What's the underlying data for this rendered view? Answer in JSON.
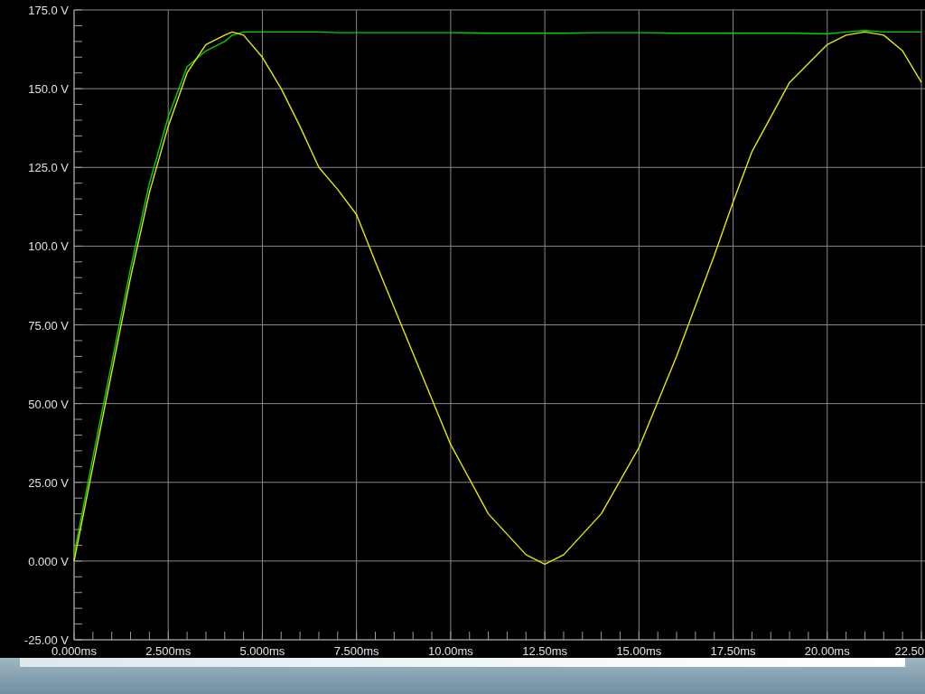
{
  "chart_data": {
    "type": "line",
    "x": [
      0,
      0.5,
      1,
      1.5,
      2,
      2.5,
      3,
      3.5,
      4,
      4.2,
      4.5,
      5,
      5.5,
      6,
      6.5,
      7,
      7.5,
      8,
      9,
      10,
      11,
      12,
      12.5,
      13,
      14,
      15,
      16,
      17,
      17.5,
      18,
      19,
      20,
      20.5,
      21,
      21.5,
      22,
      22.5
    ],
    "series": [
      {
        "color": "#e8e800",
        "values": [
          0,
          30,
          60,
          90,
          117,
          138,
          155,
          164,
          167,
          168,
          167,
          160,
          150,
          138,
          125,
          118,
          110,
          95,
          66,
          37,
          15,
          2,
          -1,
          2,
          15,
          36,
          65,
          97,
          114,
          130,
          152,
          164,
          167,
          168,
          167,
          162,
          152
        ]
      },
      {
        "color": "#00d000",
        "values": [
          2,
          33,
          63,
          93,
          120,
          141,
          157,
          162,
          165,
          167,
          168,
          168,
          168,
          168,
          168,
          167.8,
          167.8,
          167.8,
          167.8,
          167.8,
          167.6,
          167.6,
          167.6,
          167.6,
          167.8,
          167.8,
          167.6,
          167.6,
          167.6,
          167.6,
          167.6,
          167.4,
          168,
          168.5,
          168,
          168,
          168
        ]
      }
    ],
    "grid": true,
    "xlim": [
      0,
      22.5
    ],
    "ylim": [
      -25,
      175
    ],
    "xticks": [
      {
        "value": 0,
        "label": "0.000ms"
      },
      {
        "value": 2.5,
        "label": "2.500ms"
      },
      {
        "value": 5,
        "label": "5.000ms"
      },
      {
        "value": 7.5,
        "label": "7.500ms"
      },
      {
        "value": 10,
        "label": "10.00ms"
      },
      {
        "value": 12.5,
        "label": "12.50ms"
      },
      {
        "value": 15,
        "label": "15.00ms"
      },
      {
        "value": 17.5,
        "label": "17.50ms"
      },
      {
        "value": 20,
        "label": "20.00ms"
      },
      {
        "value": 22.5,
        "label": "22.50"
      }
    ],
    "yticks": [
      {
        "value": -25,
        "label": "-25.00 V"
      },
      {
        "value": 0,
        "label": "0.000 V"
      },
      {
        "value": 25,
        "label": "25.00 V"
      },
      {
        "value": 50,
        "label": "50.00 V"
      },
      {
        "value": 75,
        "label": "75.00 V"
      },
      {
        "value": 100,
        "label": "100.0 V"
      },
      {
        "value": 125,
        "label": "125.0 V"
      },
      {
        "value": 150,
        "label": "150.0 V"
      },
      {
        "value": 175,
        "label": "175.0 V"
      }
    ]
  }
}
